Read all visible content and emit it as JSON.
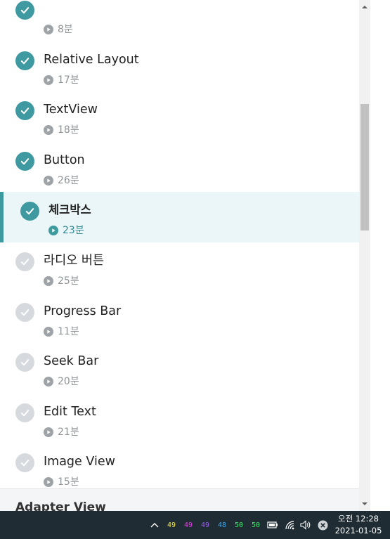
{
  "lessons": [
    {
      "title": "",
      "duration": "8분",
      "status": "done"
    },
    {
      "title": "Relative Layout",
      "duration": "17분",
      "status": "done"
    },
    {
      "title": "TextView",
      "duration": "18분",
      "status": "done"
    },
    {
      "title": "Button",
      "duration": "26분",
      "status": "done"
    },
    {
      "title": "체크박스",
      "duration": "23분",
      "status": "active"
    },
    {
      "title": "라디오 버튼",
      "duration": "25분",
      "status": "todo"
    },
    {
      "title": "Progress Bar",
      "duration": "11분",
      "status": "todo"
    },
    {
      "title": "Seek Bar",
      "duration": "20분",
      "status": "todo"
    },
    {
      "title": "Edit Text",
      "duration": "21분",
      "status": "todo"
    },
    {
      "title": "Image View",
      "duration": "15분",
      "status": "todo"
    }
  ],
  "section": {
    "title": "Adapter View"
  },
  "taskbar": {
    "indicators": [
      {
        "value": "49",
        "color": "#f5e642"
      },
      {
        "value": "49",
        "color": "#e838e8"
      },
      {
        "value": "49",
        "color": "#9b5cf0"
      },
      {
        "value": "48",
        "color": "#3aa8f0"
      },
      {
        "value": "50",
        "color": "#3ee66a"
      },
      {
        "value": "50",
        "color": "#3ee66a"
      }
    ],
    "clock_time": "오전 12:28",
    "clock_date": "2021-01-05"
  },
  "colors": {
    "accent": "#3e9aa0",
    "active_bg": "#eaf6f7",
    "todo_check": "#d6d9de"
  },
  "icons": [
    "check-icon",
    "play-icon",
    "chevron-up-icon",
    "battery-icon",
    "wifi-icon",
    "volume-icon",
    "close-circle-icon"
  ]
}
